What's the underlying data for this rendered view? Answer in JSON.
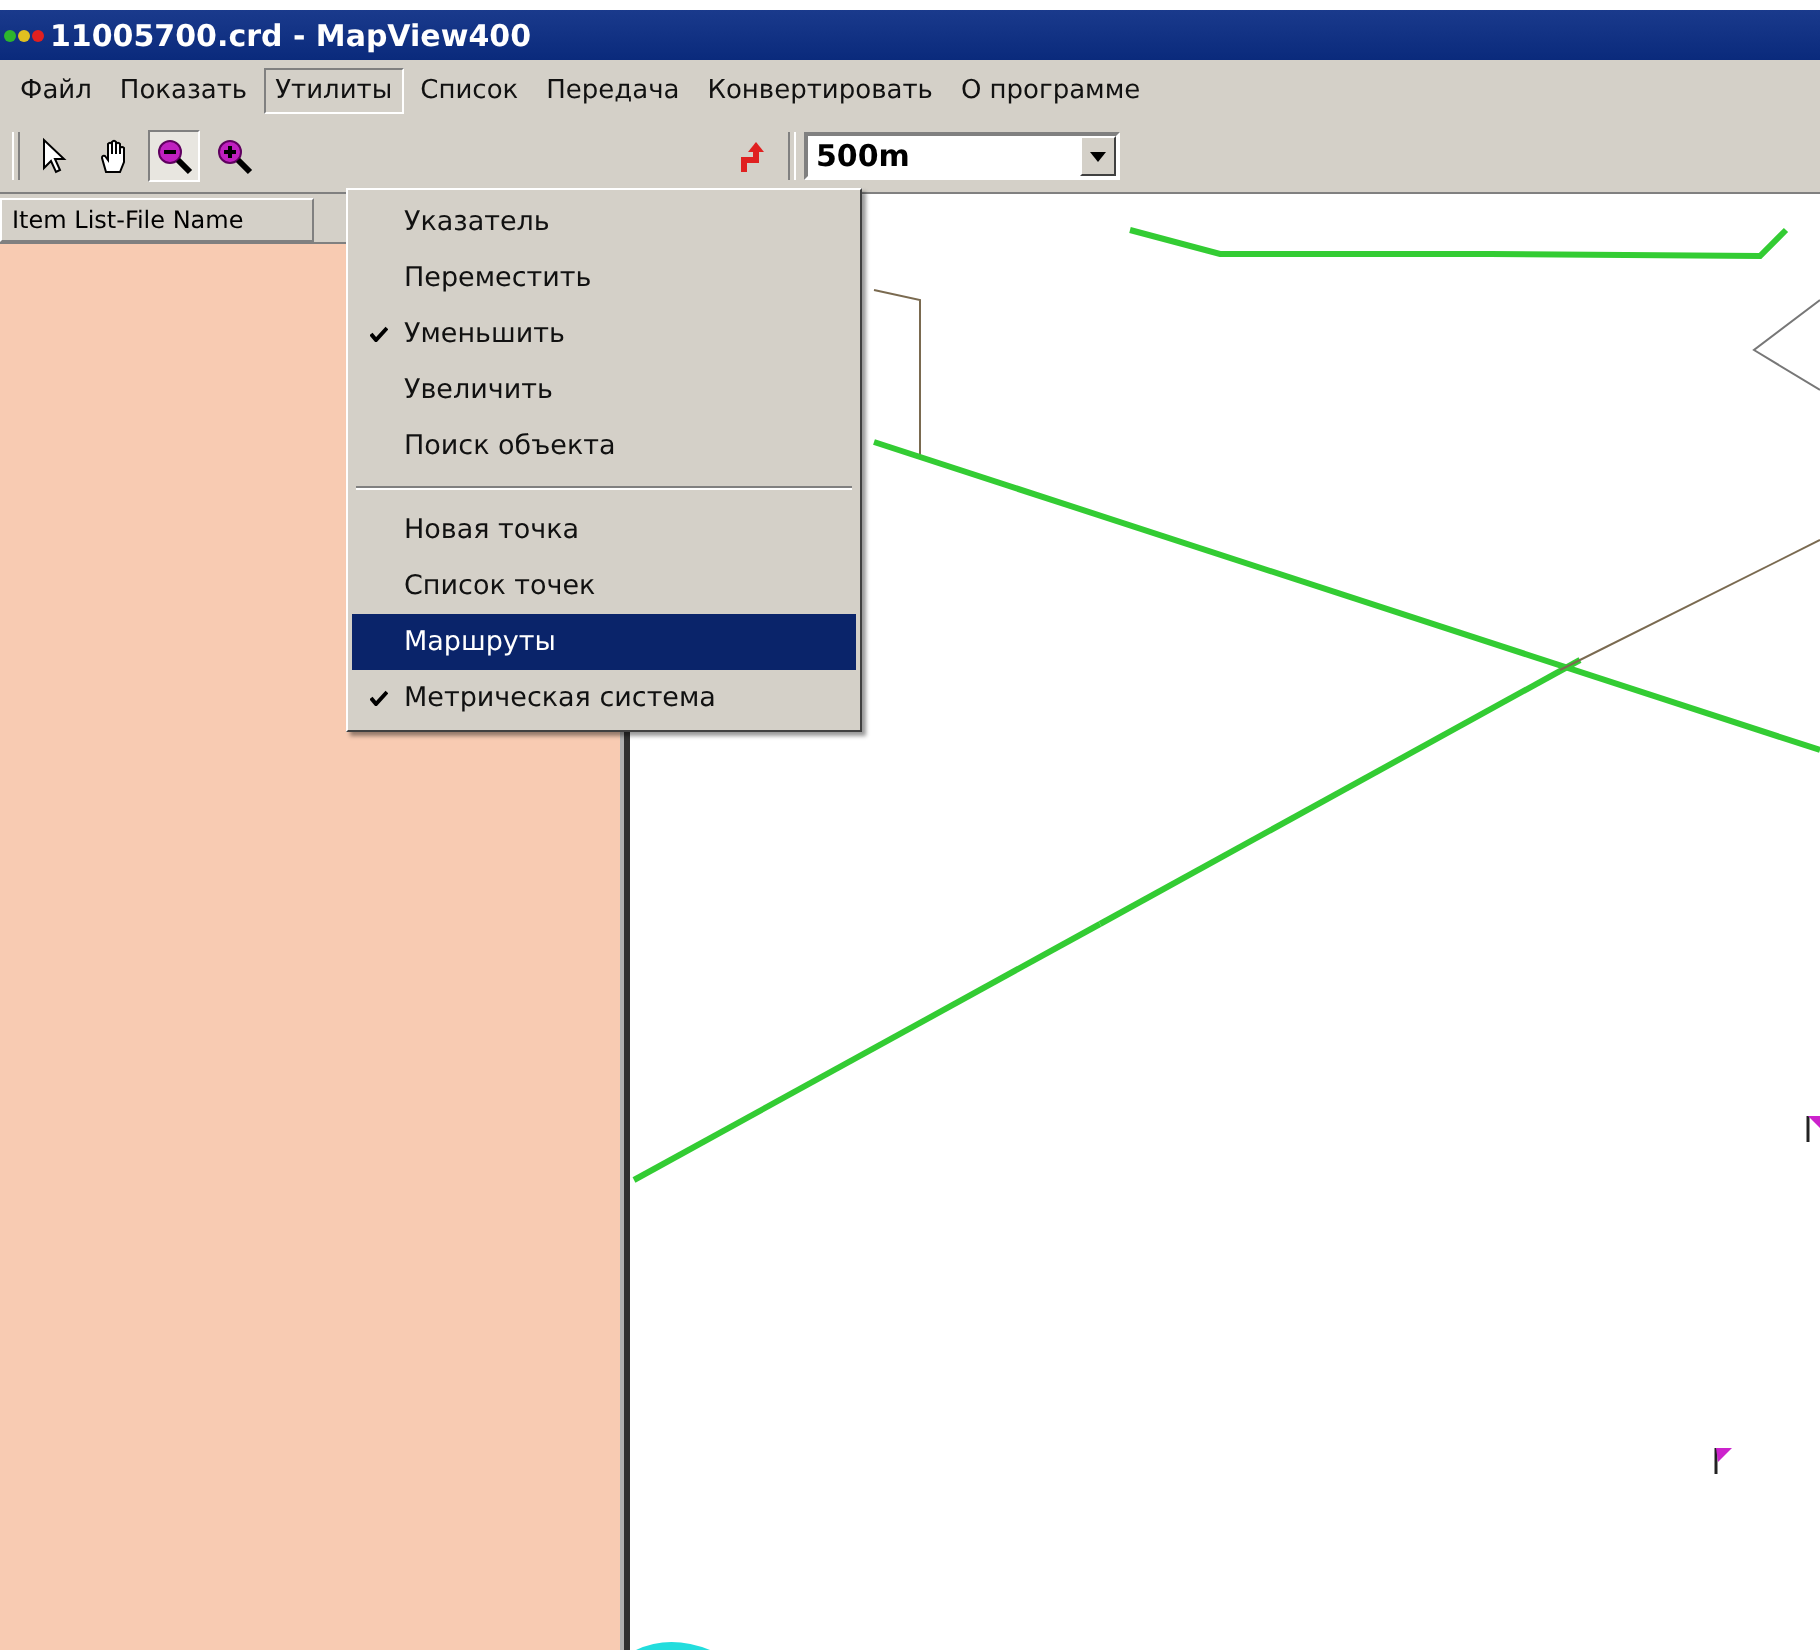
{
  "window": {
    "title": "11005700.crd - MapView400"
  },
  "menu_bar": [
    {
      "label": "Файл",
      "selected": false
    },
    {
      "label": "Показать",
      "selected": false
    },
    {
      "label": "Утилиты",
      "selected": true
    },
    {
      "label": "Список",
      "selected": false
    },
    {
      "label": "Передача",
      "selected": false
    },
    {
      "label": "Конвертировать",
      "selected": false
    },
    {
      "label": "О программе",
      "selected": false
    }
  ],
  "toolbar": {
    "tools": [
      {
        "kind": "pointer",
        "pressed": false
      },
      {
        "kind": "hand",
        "pressed": false
      },
      {
        "kind": "zoom_out",
        "pressed": true
      },
      {
        "kind": "zoom_in",
        "pressed": false
      },
      {
        "kind": "route",
        "pressed": false
      }
    ],
    "scale": {
      "value": "500m"
    }
  },
  "dropdown_menu": [
    {
      "kind": "item",
      "label": "Указатель",
      "checked": false,
      "selected": false
    },
    {
      "kind": "item",
      "label": "Переместить",
      "checked": false,
      "selected": false
    },
    {
      "kind": "item",
      "label": "Уменьшить",
      "checked": true,
      "selected": false
    },
    {
      "kind": "item",
      "label": "Увеличить",
      "checked": false,
      "selected": false
    },
    {
      "kind": "item",
      "label": "Поиск объекта",
      "checked": false,
      "selected": false
    },
    {
      "kind": "separator"
    },
    {
      "kind": "item",
      "label": "Новая точка",
      "checked": false,
      "selected": false
    },
    {
      "kind": "item",
      "label": "Список точек",
      "checked": false,
      "selected": false
    },
    {
      "kind": "item",
      "label": "Маршруты",
      "checked": false,
      "selected": true
    },
    {
      "kind": "item",
      "label": "Метрическая система",
      "checked": true,
      "selected": false
    }
  ],
  "item_list": {
    "header": "Item List-File Name"
  }
}
